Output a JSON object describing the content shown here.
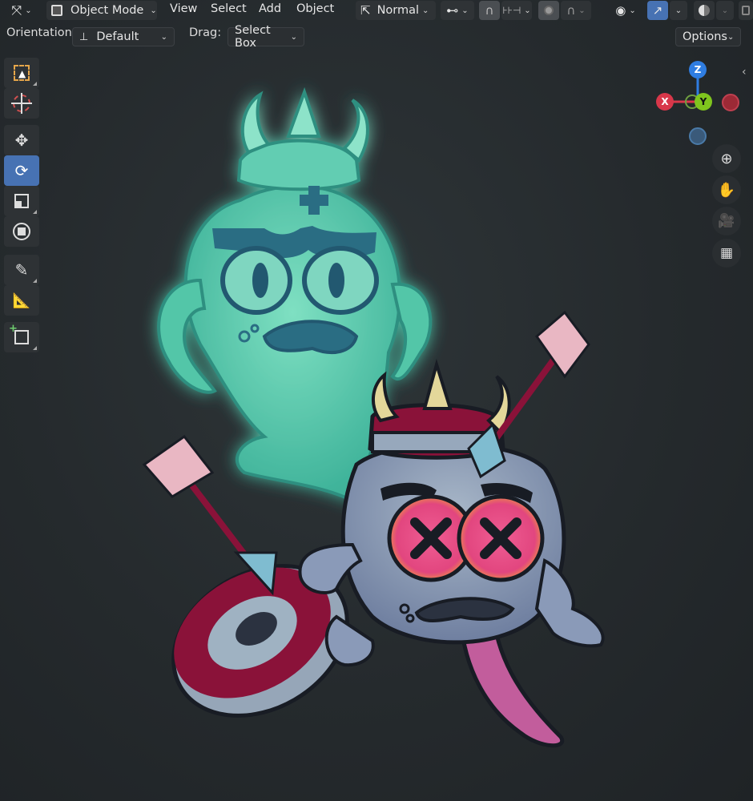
{
  "header": {
    "mode_label": "Object Mode",
    "menus": [
      "View",
      "Select",
      "Add",
      "Object"
    ],
    "transform_orientation": "Normal"
  },
  "tool_settings": {
    "orientation_label": "Orientation:",
    "orientation_value": "Default",
    "drag_label": "Drag:",
    "drag_value": "Select Box",
    "options_label": "Options"
  },
  "toolbar": {
    "tools": [
      "select-box",
      "cursor",
      "move",
      "rotate",
      "scale",
      "transform",
      "annotate",
      "measure",
      "add-cube"
    ],
    "active_tool": "rotate"
  },
  "gizmo": {
    "axes": {
      "x": "X",
      "y": "Y",
      "z": "Z"
    },
    "colors": {
      "x": "#d8374a",
      "y": "#7fc51e",
      "z": "#2f7de1",
      "neg_x": "#9c2a36",
      "neg_y": "#3a5a7a"
    }
  },
  "colors": {
    "accent": "#4772b3",
    "ghost": "#5fd1b0",
    "creature": "#8fa3b5",
    "target_red": "#8a1239",
    "eye_orange": "#f0a23a",
    "eye_pink": "#e8548a"
  }
}
